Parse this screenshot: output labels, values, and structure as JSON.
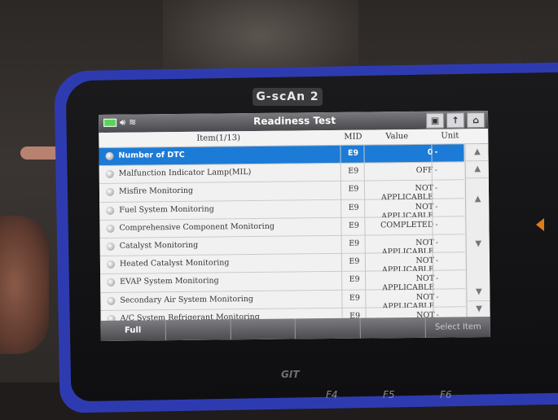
{
  "device": {
    "brand": "G-scAn 2",
    "logo": "GIT",
    "function_keys": [
      "F4",
      "F5",
      "F6"
    ]
  },
  "screen": {
    "title": "Readiness Test",
    "status_icons": [
      "battery-icon",
      "speaker-icon",
      "wifi-icon"
    ],
    "toolbar_icons": [
      "screenshot-icon",
      "upload-icon",
      "home-icon"
    ],
    "columns": {
      "item": "Item(1/13)",
      "mid": "MID",
      "value": "Value",
      "unit": "Unit"
    },
    "rows": [
      {
        "item": "Number of DTC",
        "mid": "E9",
        "value": "0",
        "unit": "-",
        "selected": true
      },
      {
        "item": "Malfunction Indicator Lamp(MIL)",
        "mid": "E9",
        "value": "OFF",
        "unit": "-"
      },
      {
        "item": "Misfire Monitoring",
        "mid": "E9",
        "value": "NOT APPLICABLE",
        "unit": "-"
      },
      {
        "item": "Fuel System Monitoring",
        "mid": "E9",
        "value": "NOT APPLICABLE",
        "unit": "-"
      },
      {
        "item": "Comprehensive Component Monitoring",
        "mid": "E9",
        "value": "COMPLETED",
        "unit": "-"
      },
      {
        "item": "Catalyst Monitoring",
        "mid": "E9",
        "value": "NOT APPLICABLE",
        "unit": "-"
      },
      {
        "item": "Heated Catalyst Monitoring",
        "mid": "E9",
        "value": "NOT APPLICABLE",
        "unit": "-"
      },
      {
        "item": "EVAP System Monitoring",
        "mid": "E9",
        "value": "NOT APPLICABLE",
        "unit": "-"
      },
      {
        "item": "Secondary Air System Monitoring",
        "mid": "E9",
        "value": "NOT APPLICABLE",
        "unit": "-"
      },
      {
        "item": "A/C System Refrigerant Monitoring",
        "mid": "E9",
        "value": "NOT APPLICABLE",
        "unit": "-"
      }
    ],
    "footer": {
      "full": "Full",
      "select_item": "Select Item"
    },
    "colors": {
      "selected_row": "#1c7bd6",
      "device_frame": "#2e3bb0"
    }
  }
}
